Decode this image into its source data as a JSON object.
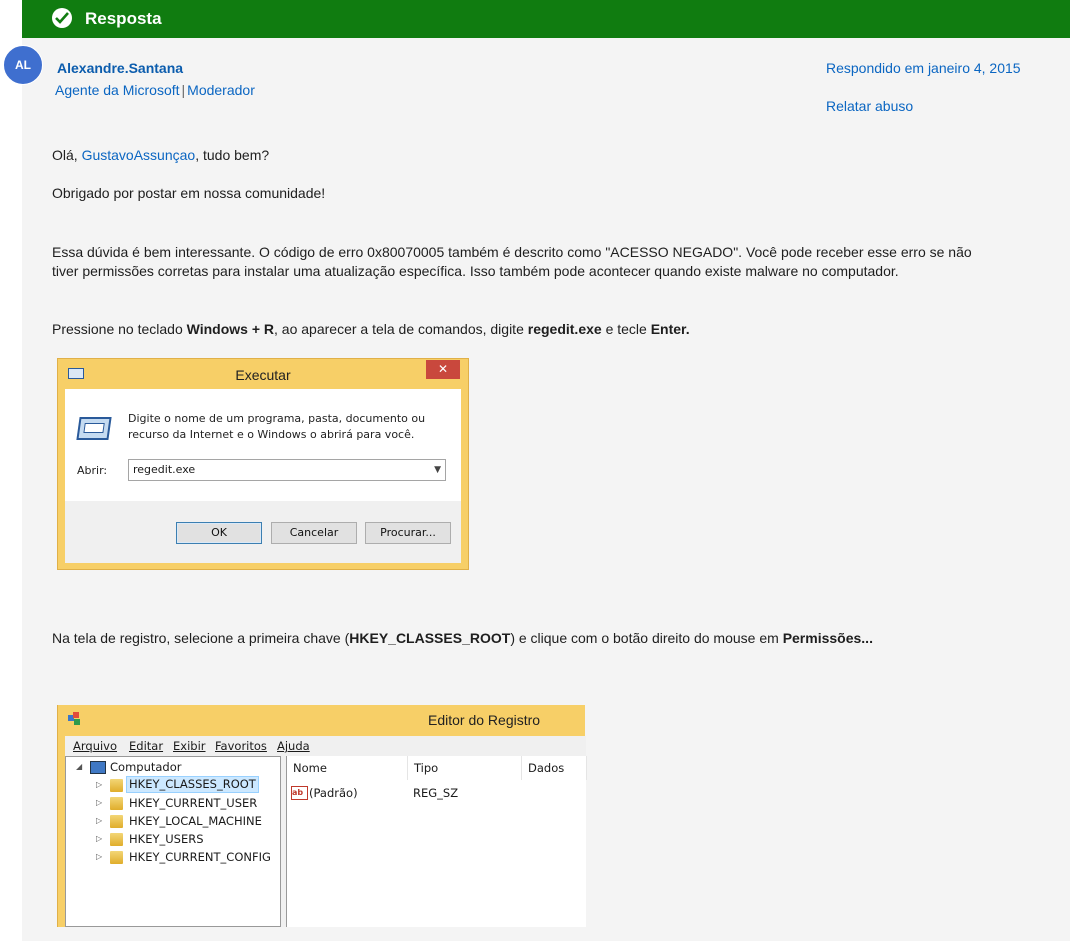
{
  "header": {
    "title": "Resposta"
  },
  "author": {
    "initials": "AL",
    "name": "Alexandre.Santana",
    "role1": "Agente da Microsoft",
    "separator": "|",
    "role2": "Moderador"
  },
  "meta": {
    "answered": "Respondido em janeiro 4, 2015",
    "report": "Relatar abuso"
  },
  "body": {
    "greet_prefix": "Olá, ",
    "greet_link": "GustavoAssunçao",
    "greet_suffix": ", tudo bem?",
    "thanks": "Obrigado por postar em nossa comunidade!",
    "para1_line1": "Essa dúvida é bem interessante. O código de erro 0x80070005 também é descrito como \"ACESSO NEGADO\". Você pode receber esse erro se não",
    "para1_line2": "tiver permissões corretas para instalar uma atualização específica. Isso também pode acontecer quando existe malware no computador.",
    "step1_a": "Pressione no teclado ",
    "step1_b": "Windows + R",
    "step1_c": ", ao aparecer a tela de comandos, digite ",
    "step1_d": "regedit.exe",
    "step1_e": " e tecle ",
    "step1_f": "Enter.",
    "step2_a": "Na tela de registro, selecione a primeira chave (",
    "step2_b": "HKEY_CLASSES_ROOT",
    "step2_c": ") e clique com o botão direito do mouse em ",
    "step2_d": "Permissões..."
  },
  "run_dialog": {
    "title": "Executar",
    "close": "✕",
    "message": "Digite o nome de um programa, pasta, documento ou recurso da Internet e o Windows o abrirá para você.",
    "open_label": "Abrir:",
    "open_value": "regedit.exe",
    "ok": "OK",
    "cancel": "Cancelar",
    "browse": "Procurar..."
  },
  "registry": {
    "title": "Editor do Registro",
    "menu": [
      "Arquivo",
      "Editar",
      "Exibir",
      "Favoritos",
      "Ajuda"
    ],
    "root": "Computador",
    "keys": [
      "HKEY_CLASSES_ROOT",
      "HKEY_CURRENT_USER",
      "HKEY_LOCAL_MACHINE",
      "HKEY_USERS",
      "HKEY_CURRENT_CONFIG"
    ],
    "columns": [
      "Nome",
      "Tipo",
      "Dados"
    ],
    "rows": [
      {
        "name": "(Padrão)",
        "type": "REG_SZ",
        "data": ""
      }
    ]
  }
}
